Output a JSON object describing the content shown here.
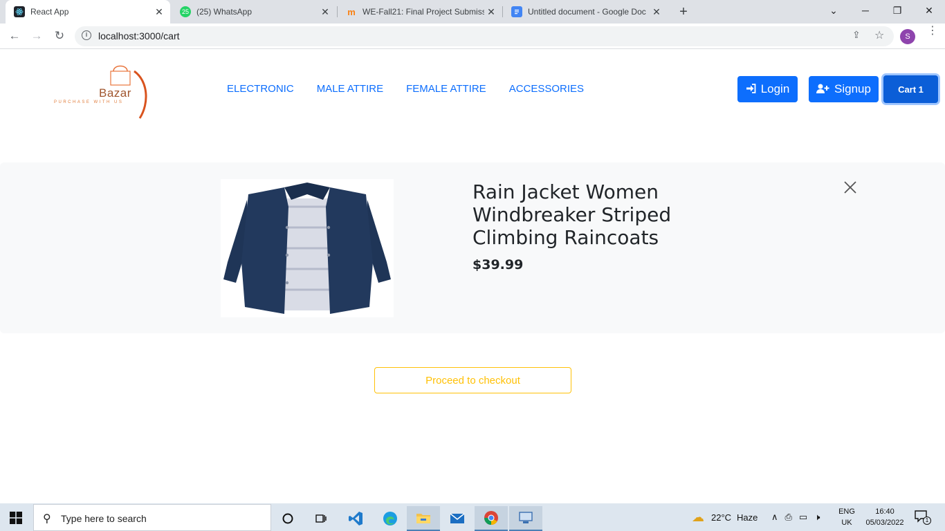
{
  "browser": {
    "tabs": [
      {
        "title": "React App",
        "favicon": "react-icon",
        "active": true
      },
      {
        "title": "(25) WhatsApp",
        "favicon": "whatsapp-icon",
        "badge": "25"
      },
      {
        "title": "WE-Fall21: Final Project Submissi",
        "favicon": "moodle-icon"
      },
      {
        "title": "Untitled document - Google Doc",
        "favicon": "google-docs-icon"
      }
    ],
    "new_tab": "+",
    "url": "localhost:3000/cart",
    "profile_initial": "S"
  },
  "site": {
    "logo": {
      "name": "Bazar",
      "tagline": "PURCHASE WITH US"
    },
    "nav_links": [
      "ELECTRONIC",
      "MALE ATTIRE",
      "FEMALE ATTIRE",
      "ACCESSORIES"
    ],
    "login_label": "Login",
    "signup_label": "Signup",
    "cart_label": "Cart 1"
  },
  "cart": {
    "items": [
      {
        "title": "Rain Jacket Women Windbreaker Striped Climbing Raincoats",
        "price": "$39.99"
      }
    ],
    "checkout_label": "Proceed to checkout"
  },
  "taskbar": {
    "search_placeholder": "Type here to search",
    "weather": {
      "temp": "22°C",
      "condition": "Haze"
    },
    "language": {
      "line1": "ENG",
      "line2": "UK"
    },
    "clock": {
      "time": "16:40",
      "date": "05/03/2022"
    },
    "notification_count": "1"
  },
  "colors": {
    "primary": "#0d6efd",
    "warning": "#ffc107",
    "cart_bg": "#f8f9fa",
    "jacket": "#1f3557"
  }
}
